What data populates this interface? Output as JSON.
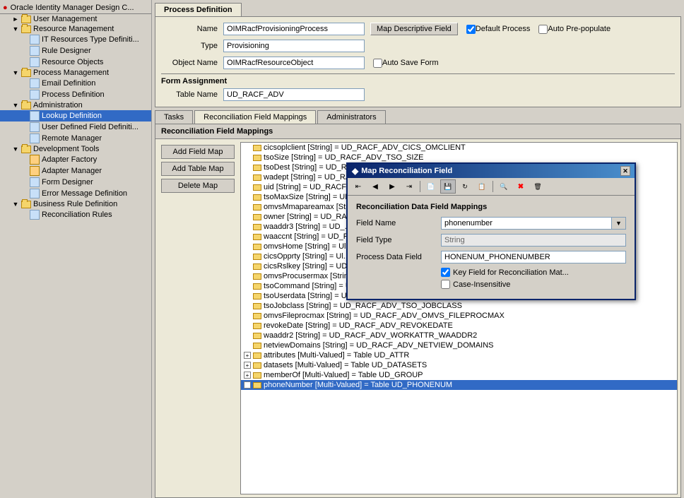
{
  "app": {
    "title": "Oracle Identity Manager Design C..."
  },
  "sidebar": {
    "items": [
      {
        "id": "root",
        "label": "Oracle Identity Manager Design C...",
        "level": 0,
        "expanded": true,
        "type": "root"
      },
      {
        "id": "user-mgmt",
        "label": "User Management",
        "level": 1,
        "expanded": false,
        "type": "folder"
      },
      {
        "id": "resource-mgmt",
        "label": "Resource Management",
        "level": 1,
        "expanded": true,
        "type": "folder"
      },
      {
        "id": "it-resources",
        "label": "IT Resources Type Definiti...",
        "level": 2,
        "expanded": false,
        "type": "item"
      },
      {
        "id": "rule-designer",
        "label": "Rule Designer",
        "level": 2,
        "expanded": false,
        "type": "item"
      },
      {
        "id": "resource-objects",
        "label": "Resource Objects",
        "level": 2,
        "expanded": false,
        "type": "item"
      },
      {
        "id": "process-mgmt",
        "label": "Process Management",
        "level": 1,
        "expanded": true,
        "type": "folder"
      },
      {
        "id": "email-def",
        "label": "Email Definition",
        "level": 2,
        "expanded": false,
        "type": "item"
      },
      {
        "id": "process-def",
        "label": "Process Definition",
        "level": 2,
        "expanded": false,
        "type": "item",
        "selected": false
      },
      {
        "id": "administration",
        "label": "Administration",
        "level": 1,
        "expanded": true,
        "type": "folder"
      },
      {
        "id": "lookup-def",
        "label": "Lookup Definition",
        "level": 2,
        "expanded": false,
        "type": "item",
        "selected": true
      },
      {
        "id": "user-defined",
        "label": "User Defined Field Definiti...",
        "level": 2,
        "expanded": false,
        "type": "item"
      },
      {
        "id": "remote-mgr",
        "label": "Remote Manager",
        "level": 2,
        "expanded": false,
        "type": "item"
      },
      {
        "id": "dev-tools",
        "label": "Development Tools",
        "level": 1,
        "expanded": true,
        "type": "folder"
      },
      {
        "id": "adapter-factory",
        "label": "Adapter Factory",
        "level": 2,
        "expanded": false,
        "type": "item"
      },
      {
        "id": "adapter-manager",
        "label": "Adapter Manager",
        "level": 2,
        "expanded": false,
        "type": "item"
      },
      {
        "id": "form-designer",
        "label": "Form Designer",
        "level": 2,
        "expanded": false,
        "type": "item"
      },
      {
        "id": "error-msg",
        "label": "Error Message Definition",
        "level": 2,
        "expanded": false,
        "type": "item"
      },
      {
        "id": "business-rule",
        "label": "Business Rule Definition",
        "level": 1,
        "expanded": false,
        "type": "folder"
      },
      {
        "id": "recon-rules",
        "label": "Reconciliation Rules",
        "level": 2,
        "expanded": false,
        "type": "item"
      }
    ]
  },
  "process_definition": {
    "tab_label": "Process Definition",
    "name_label": "Name",
    "name_value": "OIMRacfProvisioningProcess",
    "map_btn_label": "Map Descriptive Field",
    "type_label": "Type",
    "type_value": "Provisioning",
    "default_process_label": "Default Process",
    "default_process_checked": true,
    "auto_prepopulate_label": "Auto Pre-populate",
    "auto_prepopulate_checked": false,
    "object_name_label": "Object Name",
    "object_name_value": "OIMRacfResourceObject",
    "auto_save_label": "Auto Save Form",
    "auto_save_checked": false,
    "form_assignment_title": "Form Assignment",
    "table_name_label": "Table Name",
    "table_name_value": "UD_RACF_ADV"
  },
  "sub_tabs": [
    {
      "id": "tasks",
      "label": "Tasks"
    },
    {
      "id": "recon",
      "label": "Reconciliation Field Mappings",
      "active": true
    },
    {
      "id": "admins",
      "label": "Administrators"
    }
  ],
  "recon_panel": {
    "title": "Reconciliation Field Mappings",
    "add_field_btn": "Add Field Map",
    "add_table_btn": "Add Table Map",
    "delete_btn": "Delete Map"
  },
  "recon_items": [
    {
      "text": "cicsoplclient [String] = UD_RACF_ADV_CICS_OMCLIENT",
      "level": 0,
      "expanded": false
    },
    {
      "text": "tsoSize [String] = UD_RACF_ADV_TSO_SIZE",
      "level": 0,
      "expanded": false
    },
    {
      "text": "tsoDest [String] = UD_RACF_ADV_TSO_DEST",
      "level": 0,
      "expanded": false
    },
    {
      "text": "wadept [String] = UD_RA...",
      "level": 0,
      "expanded": false
    },
    {
      "text": "uid [String] = UD_RACF...",
      "level": 0,
      "expanded": false
    },
    {
      "text": "tsoMaxSize [String] = UD_...",
      "level": 0,
      "expanded": false
    },
    {
      "text": "omvsMmapareamax [Str...",
      "level": 0,
      "expanded": false
    },
    {
      "text": "owner [String] = UD_RA...",
      "level": 0,
      "expanded": false
    },
    {
      "text": "waaddr3 [String] = UD_...",
      "level": 0,
      "expanded": false
    },
    {
      "text": "waaccnt [String] = UD_R...",
      "level": 0,
      "expanded": false
    },
    {
      "text": "omvsHome [String] = Ul...",
      "level": 0,
      "expanded": false
    },
    {
      "text": "cicsOpprty [String] = Ul...",
      "level": 0,
      "expanded": false
    },
    {
      "text": "cicsRslkey [String] = UD_...",
      "level": 0,
      "expanded": false,
      "highlighted": true
    },
    {
      "text": "omvsProcusermax [String] = UD_RACF_ADV_OMVS_PROCUSERMAX",
      "level": 0,
      "expanded": false
    },
    {
      "text": "tsoCommand [String] = UD_RACF_ADV_TSO_COMMAND",
      "level": 0,
      "expanded": false
    },
    {
      "text": "tsoUserdata [String] = UD_RACF_ADV_TSO_USERDATA",
      "level": 0,
      "expanded": false
    },
    {
      "text": "tsoJobclass [String] = UD_RACF_ADV_TSO_JOBCLASS",
      "level": 0,
      "expanded": false
    },
    {
      "text": "omvsFileprocmax [String] = UD_RACF_ADV_OMVS_FILEPROCMAX",
      "level": 0,
      "expanded": false
    },
    {
      "text": "revokeDate [String] = UD_RACF_ADV_REVOKEDATE",
      "level": 0,
      "expanded": false
    },
    {
      "text": "waaddr2 [String] = UD_RACF_ADV_WORKATTR_WAADDR2",
      "level": 0,
      "expanded": false
    },
    {
      "text": "netviewDomains [String] = UD_RACF_ADV_NETVIEW_DOMAINS",
      "level": 0,
      "expanded": false
    },
    {
      "text": "attributes [Multi-Valued] = Table UD_ATTR",
      "level": 0,
      "expanded": false,
      "has_expand": true
    },
    {
      "text": "datasets [Multi-Valued] = Table UD_DATASETS",
      "level": 0,
      "expanded": false,
      "has_expand": true
    },
    {
      "text": "memberOf [Multi-Valued] = Table UD_GROUP",
      "level": 0,
      "expanded": false,
      "has_expand": true
    },
    {
      "text": "phoneNumber [Multi-Valued] = Table UD_PHONENUM",
      "level": 0,
      "expanded": false,
      "has_expand": true,
      "selected": true
    }
  ],
  "modal": {
    "title": "Map Reconciliation Field",
    "section_title": "Reconciliation Data Field Mappings",
    "field_name_label": "Field Name",
    "field_name_value": "phonenumber",
    "field_type_label": "Field Type",
    "field_type_value": "String",
    "process_data_label": "Process Data Field",
    "process_data_value": "HONENUM_PHONENUMBER",
    "key_field_label": "Key Field for Reconciliation Mat...",
    "key_field_checked": true,
    "case_insensitive_label": "Case-Insensitive",
    "case_insensitive_checked": false,
    "toolbar_buttons": [
      {
        "id": "first",
        "icon": "⏮",
        "label": "first"
      },
      {
        "id": "prev",
        "icon": "◀",
        "label": "previous"
      },
      {
        "id": "next",
        "icon": "▶",
        "label": "next"
      },
      {
        "id": "last",
        "icon": "⏭",
        "label": "last"
      },
      {
        "id": "new",
        "icon": "📄",
        "label": "new"
      },
      {
        "id": "save",
        "icon": "💾",
        "label": "save"
      },
      {
        "id": "refresh",
        "icon": "🔄",
        "label": "refresh"
      },
      {
        "id": "copy",
        "icon": "📋",
        "label": "copy"
      },
      {
        "id": "find",
        "icon": "🔍",
        "label": "find"
      },
      {
        "id": "delete",
        "icon": "✖",
        "label": "delete"
      },
      {
        "id": "clear",
        "icon": "🗑",
        "label": "clear"
      }
    ]
  }
}
